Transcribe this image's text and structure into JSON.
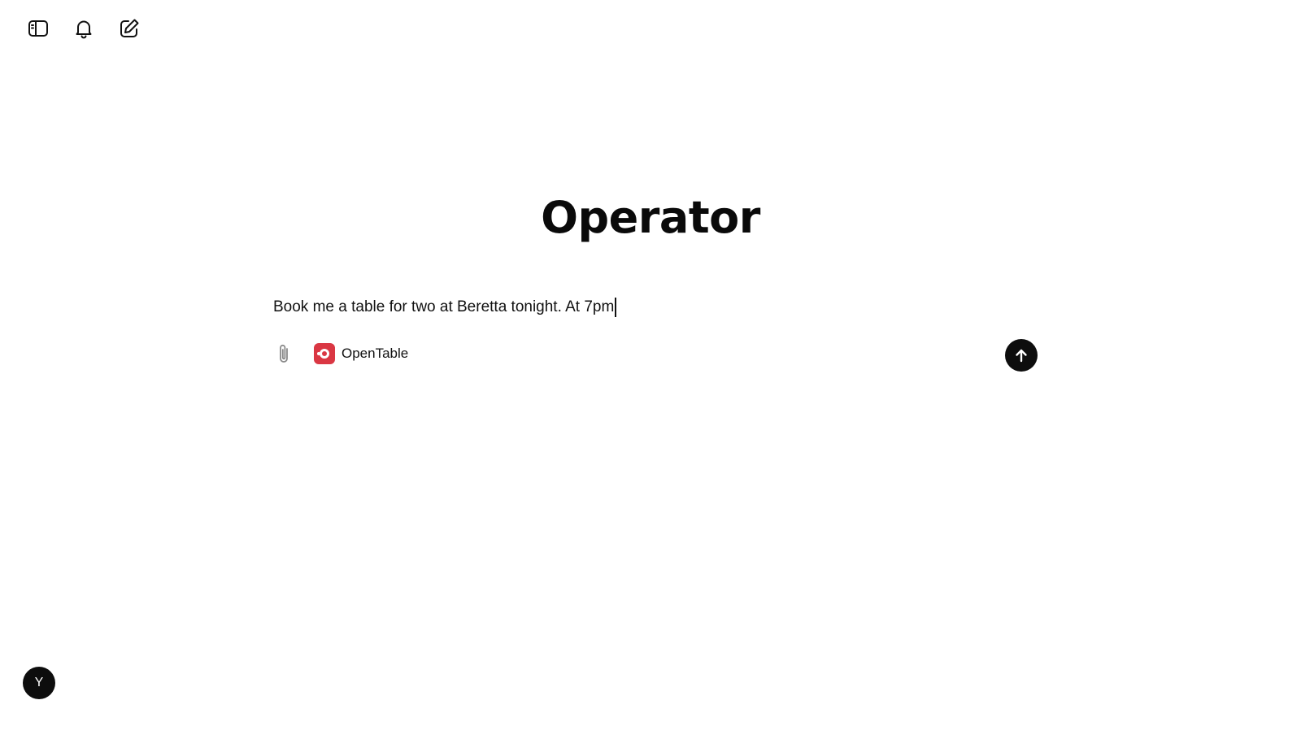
{
  "app": {
    "title": "Operator"
  },
  "toolbar": {
    "items": [
      {
        "icon": "sidebar-toggle-icon"
      },
      {
        "icon": "bell-icon"
      },
      {
        "icon": "new-task-edit-icon"
      }
    ]
  },
  "composer": {
    "prompt_value": "Book me a table for two at Beretta tonight. At 7pm",
    "attach_icon": "paperclip-icon",
    "site": {
      "label": "OpenTable",
      "logo_icon": "opentable-logo-icon",
      "brand_color": "#da3743"
    },
    "send_icon": "arrow-up-icon"
  },
  "user": {
    "avatar_initial": "Y"
  }
}
